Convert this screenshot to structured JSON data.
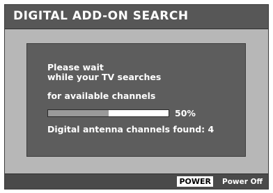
{
  "header": {
    "title": "DIGITAL ADD-ON SEARCH"
  },
  "dialog": {
    "line1": "Please wait",
    "line2": "while your TV searches",
    "line3": "for available channels",
    "progress": {
      "percent": 50,
      "label": "50%"
    },
    "found_text": "Digital antenna channels found: 4"
  },
  "footer": {
    "key_label": "POWER",
    "action_label": "Power Off"
  },
  "colors": {
    "title_bar": "#575757",
    "background": "#b7b7b7",
    "panel": "#5d5d5d",
    "progress_fill": "#9a9a9a",
    "progress_track": "#ffffff",
    "footer_bar": "#4a4a4a"
  }
}
